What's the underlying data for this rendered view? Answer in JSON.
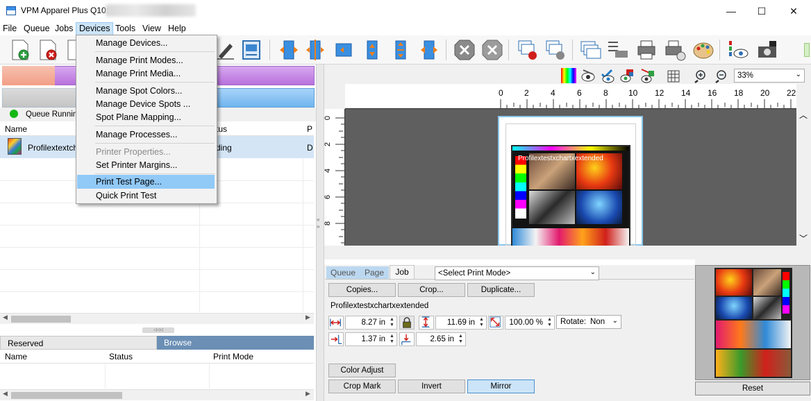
{
  "window": {
    "title": "VPM Apparel Plus Q10:",
    "minimize": "—",
    "maximize": "☐",
    "close": "✕"
  },
  "menubar": [
    "File",
    "Queue",
    "Jobs",
    "Devices",
    "Tools",
    "View",
    "Help"
  ],
  "devices_menu": {
    "items": [
      {
        "label": "Manage Devices...",
        "disabled": false
      },
      {
        "label": "Manage Print Modes...",
        "disabled": false
      },
      {
        "label": "Manage Print Media...",
        "disabled": false
      },
      {
        "label": "Manage Spot Colors...",
        "disabled": false
      },
      {
        "label": "Manage Device Spots ...",
        "disabled": false
      },
      {
        "label": "Spot Plane Mapping...",
        "disabled": false
      },
      {
        "label": "Manage Processes...",
        "disabled": false
      },
      {
        "label": "Printer Properties...",
        "disabled": true
      },
      {
        "label": "Set Printer Margins...",
        "disabled": false
      },
      {
        "label": "Print Test Page...",
        "disabled": false
      },
      {
        "label": "Quick Print Test",
        "disabled": false
      }
    ],
    "highlighted": "Print Test Page..."
  },
  "queue": {
    "status": "Queue Running",
    "status_color": "#14b814",
    "columns": [
      "Name",
      "tus",
      "P"
    ],
    "rows": [
      {
        "name": "Profilextextch",
        "status": "ding",
        "p": "D"
      }
    ]
  },
  "reserved_panel": {
    "tabs": [
      "Reserved",
      "Browse"
    ],
    "columns": [
      "Name",
      "Status",
      "Print Mode"
    ]
  },
  "preview": {
    "zoom": "33%",
    "ruler_h": [
      "0",
      "2",
      "4",
      "6",
      "8",
      "10",
      "12",
      "14",
      "16",
      "18",
      "20",
      "22"
    ],
    "ruler_v": [
      "0",
      "2",
      "4",
      "6",
      "8"
    ],
    "image_label": "Profilextestxchartxextended"
  },
  "job_settings": {
    "tabs": [
      "Queue",
      "Page",
      "Job"
    ],
    "active_tab": "Job",
    "print_mode_placeholder": "<Select Print Mode>",
    "buttons": {
      "copies": "Copies...",
      "crop": "Crop...",
      "duplicate": "Duplicate..."
    },
    "job_name": "Profilextestxchartxextended",
    "width": "8.27 in",
    "height": "11.69 in",
    "scale": "100.00 %",
    "rotate_label": "Rotate:",
    "rotate_value": "Non",
    "offset_x": "1.37 in",
    "offset_y": "2.65 in",
    "color_adjust": "Color Adjust",
    "crop_mark": "Crop Mark",
    "invert": "Invert",
    "mirror": "Mirror",
    "reset": "Reset"
  },
  "colors": {
    "accent": "#cce4f7",
    "menu_highlight": "#91c9f7",
    "browse_tab": "#6b8fb5",
    "preview_border": "#89c6ec"
  }
}
